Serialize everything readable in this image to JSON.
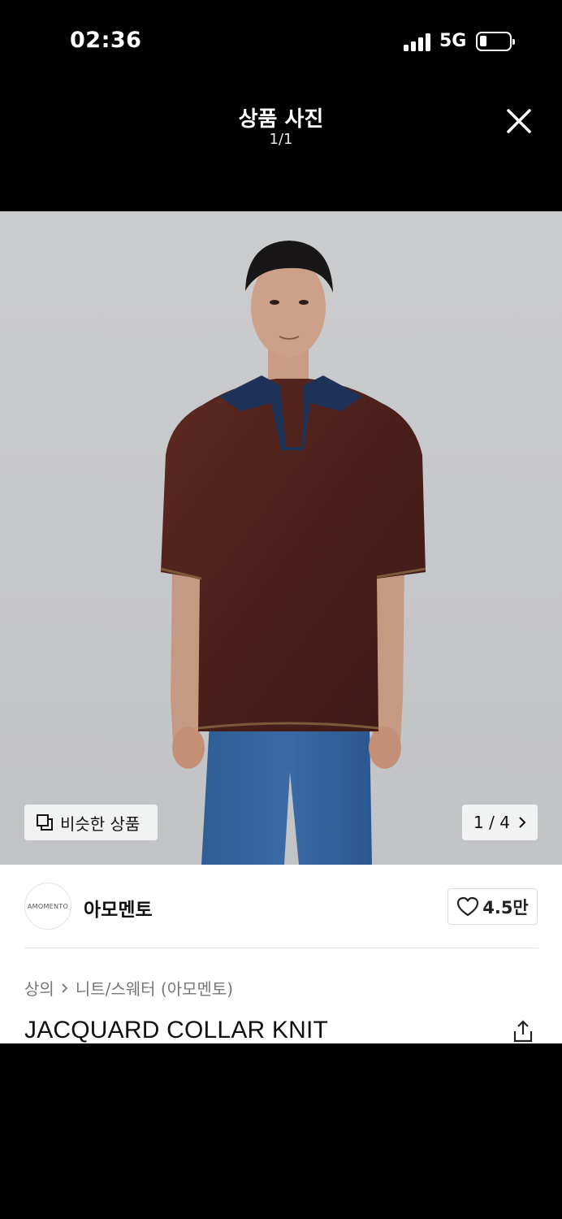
{
  "status_bar": {
    "time": "02:36",
    "network": "5G"
  },
  "viewer": {
    "title": "상품 사진",
    "counter": "1/1"
  },
  "image": {
    "similar_label": "비슷한 상품",
    "page_indicator": "1 / 4"
  },
  "brand": {
    "logo_text": "AMOMENTO",
    "name": "아모멘토"
  },
  "like": {
    "count": "4.5만"
  },
  "breadcrumb": {
    "category": "상의",
    "subcategory": "니트/스웨터 (아모멘토)"
  },
  "product": {
    "name": "JACQUARD COLLAR KNIT"
  },
  "colors": {
    "background": "#000000",
    "panel": "#ffffff",
    "photo_bg": "#c9cacc"
  }
}
